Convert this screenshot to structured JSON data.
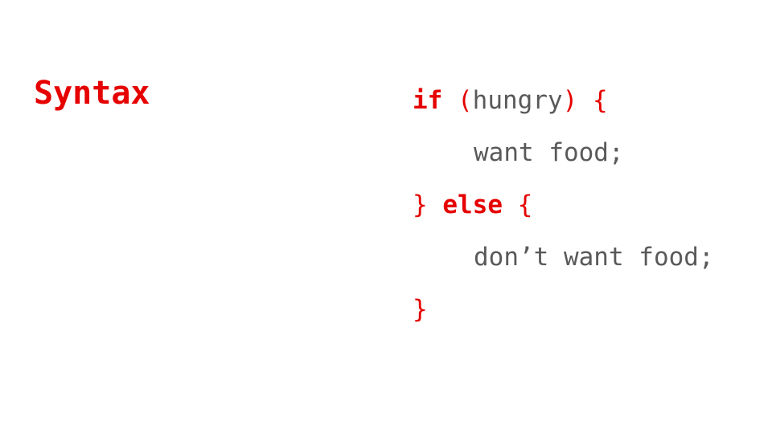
{
  "slide": {
    "title": "Syntax",
    "code": {
      "line1": {
        "keyword": "if",
        "space": " ",
        "open_paren": "(",
        "condition": "hungry",
        "close_paren": ")",
        "space2": " ",
        "open_brace": "{"
      },
      "line2": {
        "statement": "want food;"
      },
      "line3": {
        "close_brace": "}",
        "space": " ",
        "keyword": "else",
        "space2": " ",
        "open_brace": "{"
      },
      "line4": {
        "statement": "don’t want food;"
      },
      "line5": {
        "close_brace": "}"
      }
    },
    "colors": {
      "accent": "#e60000",
      "code_text": "#595959",
      "background": "#ffffff"
    }
  }
}
